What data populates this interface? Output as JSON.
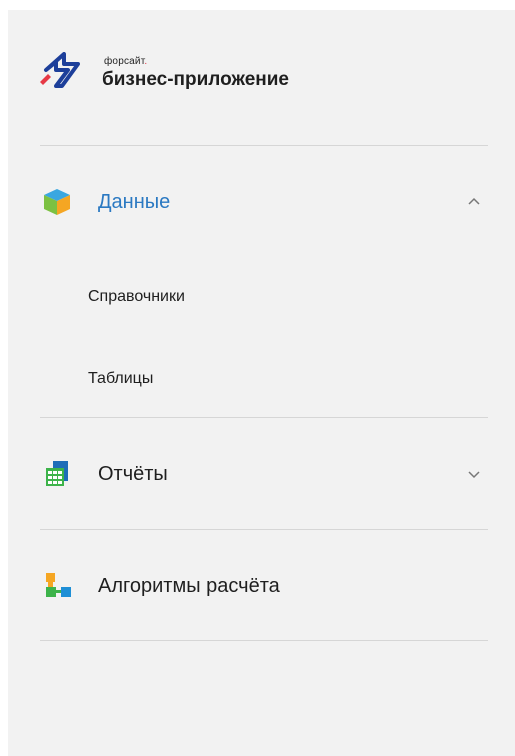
{
  "brand": {
    "small_text": "форсайт",
    "small_dot": ".",
    "name": "бизнес-приложение"
  },
  "nav": {
    "data": {
      "label": "Данные",
      "icon": "cube-icon",
      "expanded": true,
      "subitems": [
        {
          "label": "Справочники"
        },
        {
          "label": "Таблицы"
        }
      ]
    },
    "reports": {
      "label": "Отчёты",
      "icon": "table-report-icon",
      "expanded": false
    },
    "algorithms": {
      "label": "Алгоритмы расчёта",
      "icon": "flowchart-icon"
    }
  },
  "colors": {
    "active": "#2b79c2",
    "panel_bg": "#f2f2f2",
    "brand_blue": "#1d3f9a",
    "brand_red": "#e63946"
  }
}
